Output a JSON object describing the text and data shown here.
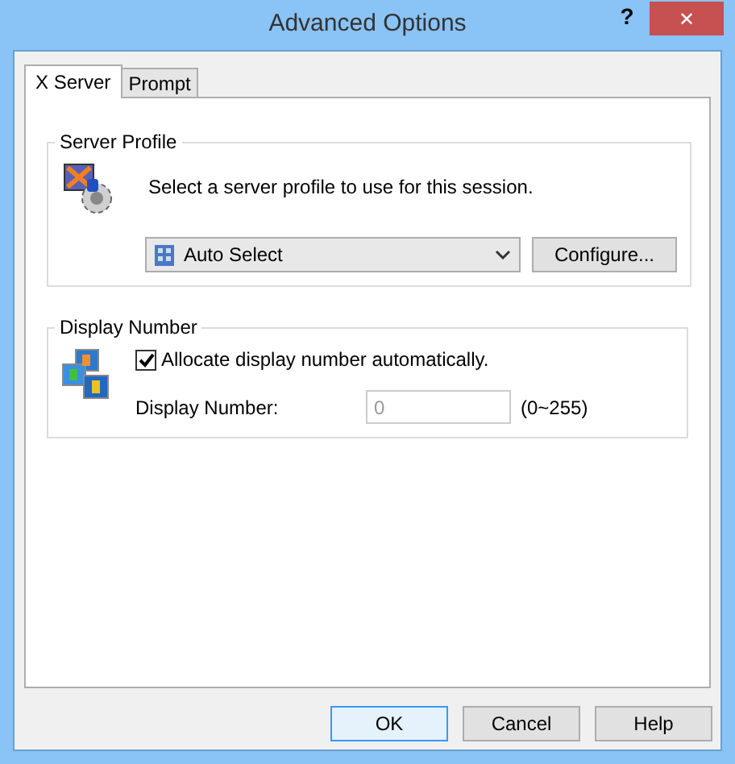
{
  "window": {
    "title": "Advanced Options",
    "help_glyph": "?",
    "close_glyph": "✕"
  },
  "tabs": [
    {
      "label": "X Server",
      "selected": true
    },
    {
      "label": "Prompt",
      "selected": false
    }
  ],
  "server_profile": {
    "title": "Server Profile",
    "description": "Select a server profile to use for this session.",
    "profile_select": {
      "value": "Auto Select"
    },
    "configure_button": "Configure..."
  },
  "display_number": {
    "title": "Display Number",
    "auto_checkbox": {
      "label": "Allocate display number automatically.",
      "checked": true
    },
    "field_label": "Display Number:",
    "field": {
      "value": "0",
      "disabled": true
    },
    "range": "(0~255)"
  },
  "buttons": [
    {
      "label": "OK",
      "default": true
    },
    {
      "label": "Cancel",
      "default": false
    },
    {
      "label": "Help",
      "default": false
    }
  ]
}
